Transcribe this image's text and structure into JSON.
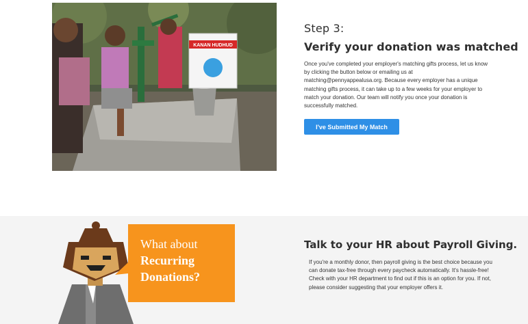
{
  "step": {
    "label": "Step 3:",
    "title": "Verify your donation was matched",
    "body": "Once you've completed your employer's matching gifts process, let us know by clicking the button below or emailing us at matching@pennyappealusa.org. Because every employer has a unique matching gifts process, it can take up to a few weeks for your employer to match your donation. Our team will notify you once your donation is successfully matched.",
    "button_label": "I've Submitted My Match",
    "photo_sign_text": "KANAN HUDHUD"
  },
  "payroll": {
    "bubble_line1": "What about",
    "bubble_line2": "Recurring",
    "bubble_line3": "Donations?",
    "title": "Talk to your HR about Payroll Giving.",
    "body": "If you're a monthly donor, then payroll giving is the best choice because you can donate tax-free through every paycheck automatically. It's hassle-free! Check with your HR department to find out if this is an option for you. If not, please consider suggesting that your employer offers it."
  },
  "colors": {
    "button": "#2e8fe6",
    "bubble": "#f7941d",
    "section_bg": "#f4f4f4"
  },
  "icons": {
    "photo": "water-pump-photo",
    "illustration": "person-with-speech-bubble"
  }
}
